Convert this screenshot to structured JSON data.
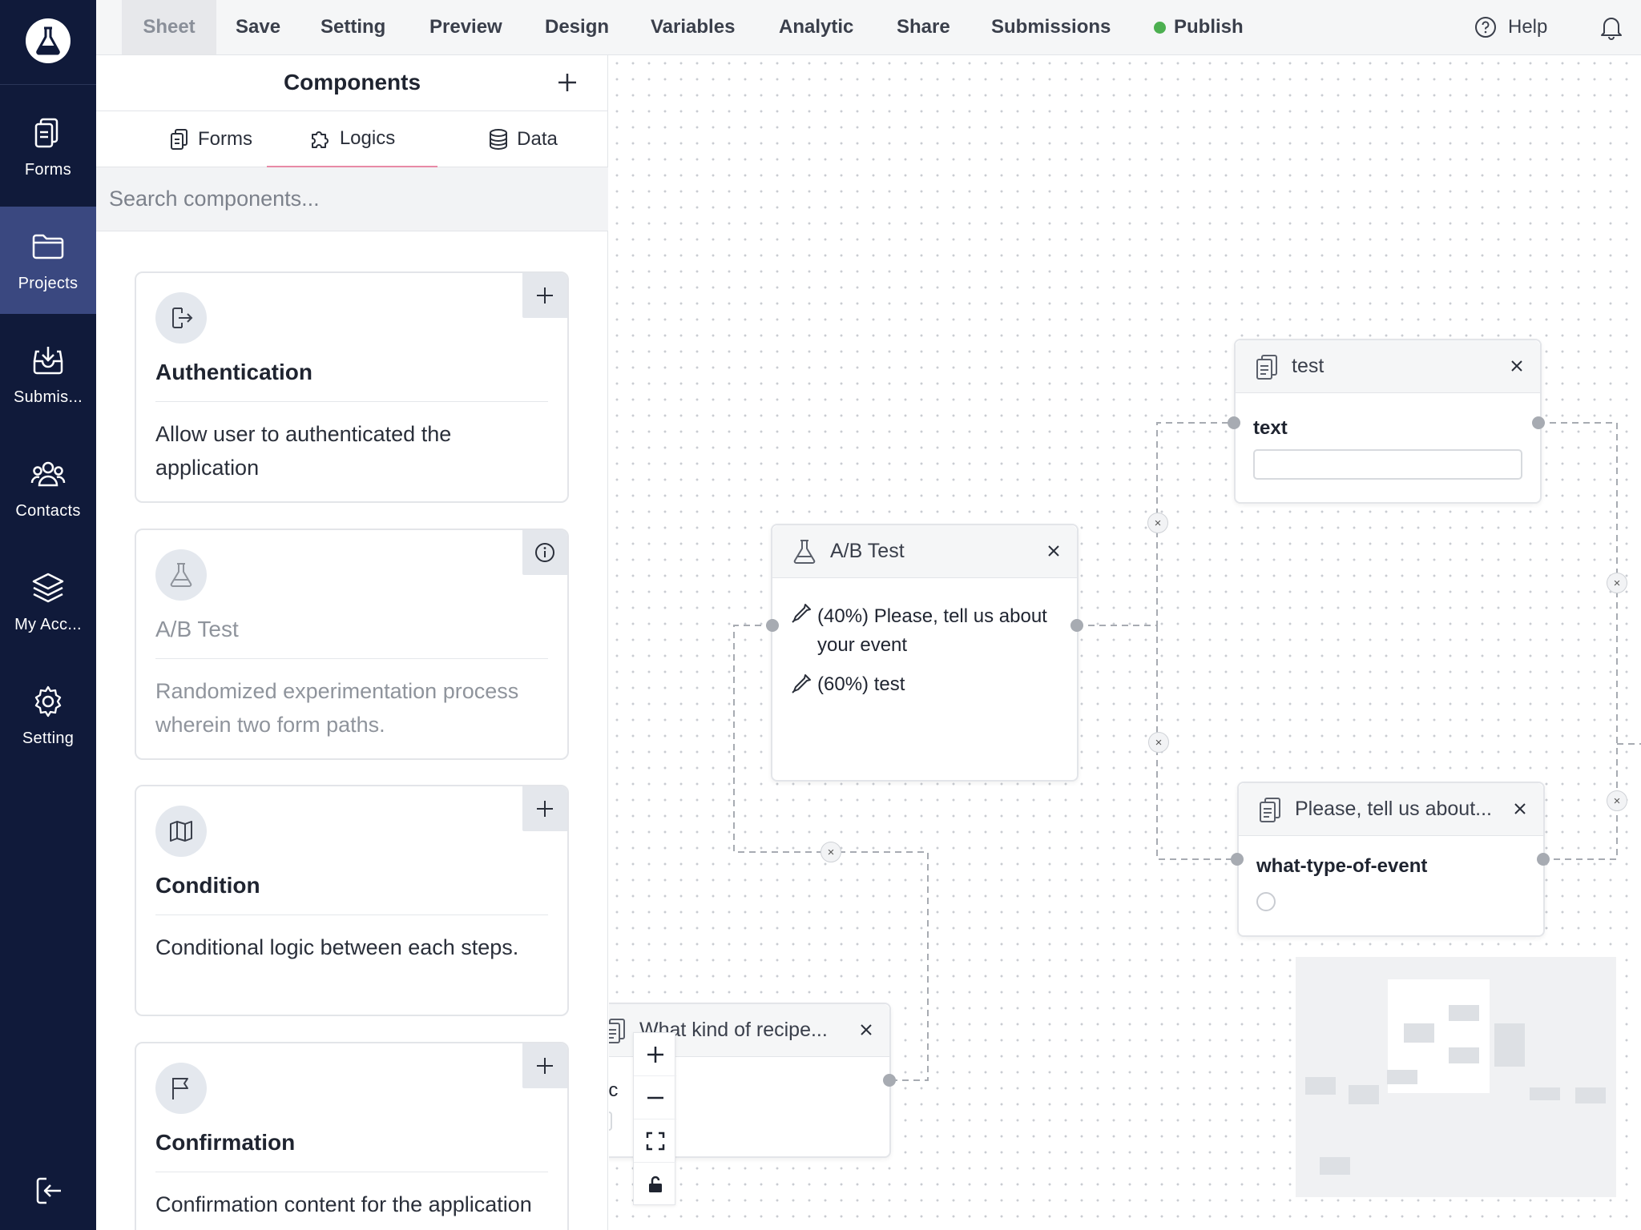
{
  "sidebar": {
    "items": [
      {
        "label": "Forms",
        "icon": "forms-icon",
        "active": false
      },
      {
        "label": "Projects",
        "icon": "folder-icon",
        "active": true
      },
      {
        "label": "Submis...",
        "icon": "inbox-icon",
        "active": false
      },
      {
        "label": "Contacts",
        "icon": "users-icon",
        "active": false
      },
      {
        "label": "My Acc...",
        "icon": "layers-icon",
        "active": false
      },
      {
        "label": "Setting",
        "icon": "gear-icon",
        "active": false
      }
    ]
  },
  "menu": {
    "sheet": "Sheet",
    "save": "Save",
    "setting": "Setting",
    "preview": "Preview",
    "design": "Design",
    "variables": "Variables",
    "analytic": "Analytic",
    "share": "Share",
    "submissions": "Submissions",
    "publish": "Publish",
    "help": "Help"
  },
  "panel": {
    "title": "Components",
    "tabs": [
      "Forms",
      "Logics",
      "Data"
    ],
    "active_tab": "Logics",
    "search_placeholder": "Search components..."
  },
  "components": [
    {
      "title": "Authentication",
      "desc": "Allow user to authenticated the application",
      "icon": "logout-icon",
      "action": "add",
      "disabled": false
    },
    {
      "title": "A/B Test",
      "desc": "Randomized experimentation process wherein two form paths.",
      "icon": "flask-icon",
      "action": "info",
      "disabled": true
    },
    {
      "title": "Condition",
      "desc": "Conditional logic between each steps.",
      "icon": "map-icon",
      "action": "add",
      "disabled": false
    },
    {
      "title": "Confirmation",
      "desc": "Confirmation content for the application",
      "icon": "flag-icon",
      "action": "add",
      "disabled": false
    }
  ],
  "canvas": {
    "ab_node": {
      "title": "A/B Test",
      "branch1": "(40%) Please, tell us about your event",
      "branch2": "(60%) test"
    },
    "test_node": {
      "title": "test",
      "field_label": "text"
    },
    "event_node": {
      "title": "Please, tell us about...",
      "field_label": "what-type-of-event"
    },
    "recipe_node": {
      "title": "What kind of recipe...",
      "field_label": "rec"
    }
  },
  "colors": {
    "sidebar_bg": "#101a3a",
    "sidebar_active": "#3a4880",
    "publish_dot": "#4caf50",
    "tab_underline": "#e88aa6"
  }
}
